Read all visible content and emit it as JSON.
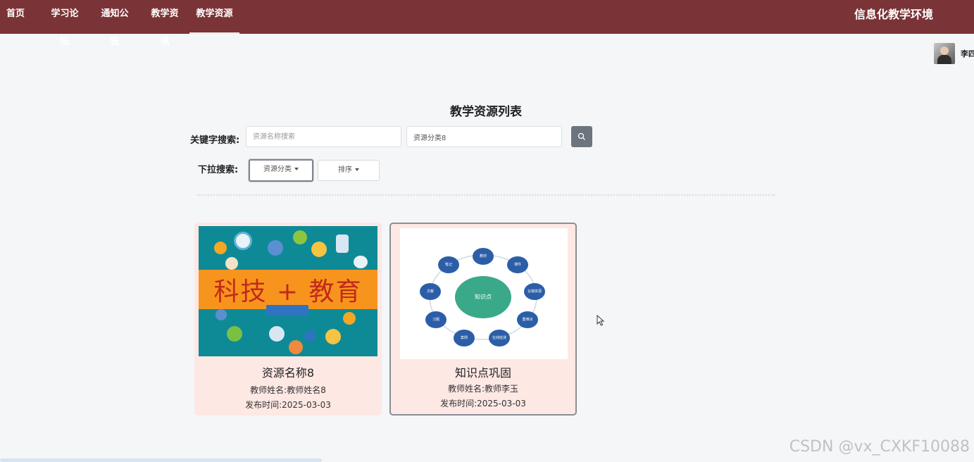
{
  "nav": {
    "items": [
      {
        "label": "首页",
        "active": false
      },
      {
        "label": "学习论坛",
        "active": false
      },
      {
        "label": "通知公告",
        "active": false
      },
      {
        "label": "教学资讯",
        "active": false
      },
      {
        "label": "教学资源",
        "active": true
      }
    ],
    "brand": "信息化教学环境"
  },
  "user": {
    "name": "李四"
  },
  "page_title": "教学资源列表",
  "search": {
    "keyword_label": "关键字搜索:",
    "name_placeholder": "资源名称搜索",
    "category_value": "资源分类8",
    "dropdown_label": "下拉搜索:",
    "category_dropdown": "资源分类",
    "sort_dropdown": "排序"
  },
  "cards": [
    {
      "image_text": "科技 + 教育",
      "title": "资源名称8",
      "teacher": "教师姓名:教师姓名8",
      "date": "发布时间:2025-03-03"
    },
    {
      "image_center": "知识点",
      "image_nodes": [
        "教材",
        "课件",
        "云端资源",
        "重难点",
        "在线检测",
        "案例",
        "习题",
        "文献",
        "笔记"
      ],
      "title": "知识点巩固",
      "teacher": "教师姓名:教师李玉",
      "date": "发布时间:2025-03-03"
    }
  ],
  "watermark": "CSDN @vx_CXKF10088",
  "colors": {
    "navbar": "#7a3336",
    "card_bg": "#fde8e4",
    "search_button": "#6c757d"
  }
}
